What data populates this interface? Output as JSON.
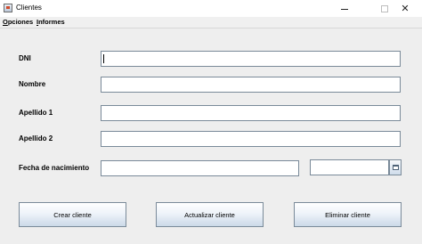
{
  "window": {
    "title": "Clientes",
    "close_glyph": "✕"
  },
  "menu": {
    "items": [
      {
        "label": "Opciones"
      },
      {
        "label": "Informes"
      }
    ]
  },
  "form": {
    "fields": [
      {
        "label": "DNI",
        "value": ""
      },
      {
        "label": "Nombre",
        "value": ""
      },
      {
        "label": "Apellido 1",
        "value": ""
      },
      {
        "label": "Apellido 2",
        "value": ""
      },
      {
        "label": "Fecha de nacimiento",
        "value": ""
      }
    ],
    "date_picker_value": "",
    "calendar_icon": "calendar-icon"
  },
  "buttons": {
    "create": "Crear cliente",
    "update": "Actualizar cliente",
    "delete": "Eliminar cliente"
  },
  "colors": {
    "panel_bg": "#eeeeee",
    "field_border": "#7a8a99",
    "button_gradient_bottom": "#cbd9e8"
  }
}
